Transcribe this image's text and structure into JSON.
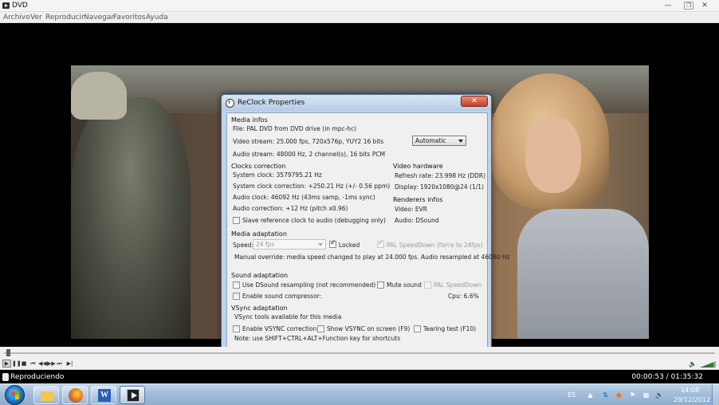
{
  "window": {
    "title": "DVD"
  },
  "menu": [
    "Archivo",
    "Ver",
    "Reproducir",
    "Navegar",
    "Favoritos",
    "Ayuda"
  ],
  "dialog": {
    "title": "ReClock Properties",
    "close_symbol": "✕",
    "media_infos": {
      "heading": "Media infos",
      "file": "File:  PAL DVD from DVD drive (in mpc-hc)",
      "video_stream": "Video stream: 25.000 fps, 720x576p, YUY2 16 bits",
      "audio_stream": "Audio stream: 48000 Hz, 2 channel(s), 16 bits PCM",
      "mode_select": "Automatic"
    },
    "clocks_correction": {
      "heading": "Clocks correction",
      "system_clock": "System clock: 3579795.21 Hz",
      "system_clock_correction": "System clock correction:  +250.21 Hz (+/- 0.56 ppm)",
      "audio_clock": "Audio clock: 46092 Hz (43ms samp, -1ms sync)",
      "audio_correction": "Audio correction: +12 Hz (pitch x0.96)",
      "slave_checkbox": "Slave reference clock to audio (debugging only)"
    },
    "video_hardware": {
      "heading": "Video hardware",
      "refresh_rate": "Refresh rate:  23.998 Hz (DDR)",
      "display": "Display:  1920x1080@24 (1/1)"
    },
    "renderers_infos": {
      "heading": "Renderers infos",
      "video": "Video: EVR",
      "audio": "Audio: DSound"
    },
    "media_adaptation": {
      "heading": "Media adaptation",
      "speed_label": "Speed:",
      "speed_value": "24 fps",
      "locked": "Locked",
      "pal_speeddown": "PAL SpeedDown (force to 24fps)",
      "manual_override": "Manual override: media speed changed to play at 24.000 fps. Audio resampled at 46080 Hz"
    },
    "sound_adaptation": {
      "heading": "Sound adaptation",
      "dsound_resampling": "Use DSound resampling (not recommended)",
      "mute_sound": "Mute sound",
      "pal_speeddown": "PAL SpeedDown",
      "sound_compressor": "Enable sound compressor:",
      "cpu": "Cpu:  6.6%"
    },
    "vsync_adaptation": {
      "heading": "VSync adaptation",
      "available": "VSync tools available for this media",
      "enable_vsync": "Enable VSYNC correction",
      "show_vsync": "Show VSYNC on screen (F9)",
      "tearing_test": "Tearing test (F10)",
      "note": "Note: use SHIFT+CTRL+ALT+Function key for shortcuts"
    }
  },
  "player": {
    "seek_progress": 0.0056,
    "status": "Reproduciendo",
    "time": "00:00:53 / 01:35:32",
    "buttons": [
      "play-icon",
      "pause-icon",
      "stop-icon",
      "skip-back-icon",
      "rewind-icon",
      "fast-forward-icon",
      "skip-forward-icon",
      "frame-step-icon"
    ]
  },
  "taskbar": {
    "apps": [
      "folder-icon",
      "firefox-icon",
      "word-icon",
      "mpc-hc-icon"
    ],
    "language": "ES",
    "time": "14:08",
    "date": "29/12/2012"
  },
  "colors": {
    "dialog_frame": "#bcd3ea",
    "dialog_body": "#f0f0f0",
    "close_button": "#c4402a",
    "taskbar": "#a1bcd8"
  }
}
